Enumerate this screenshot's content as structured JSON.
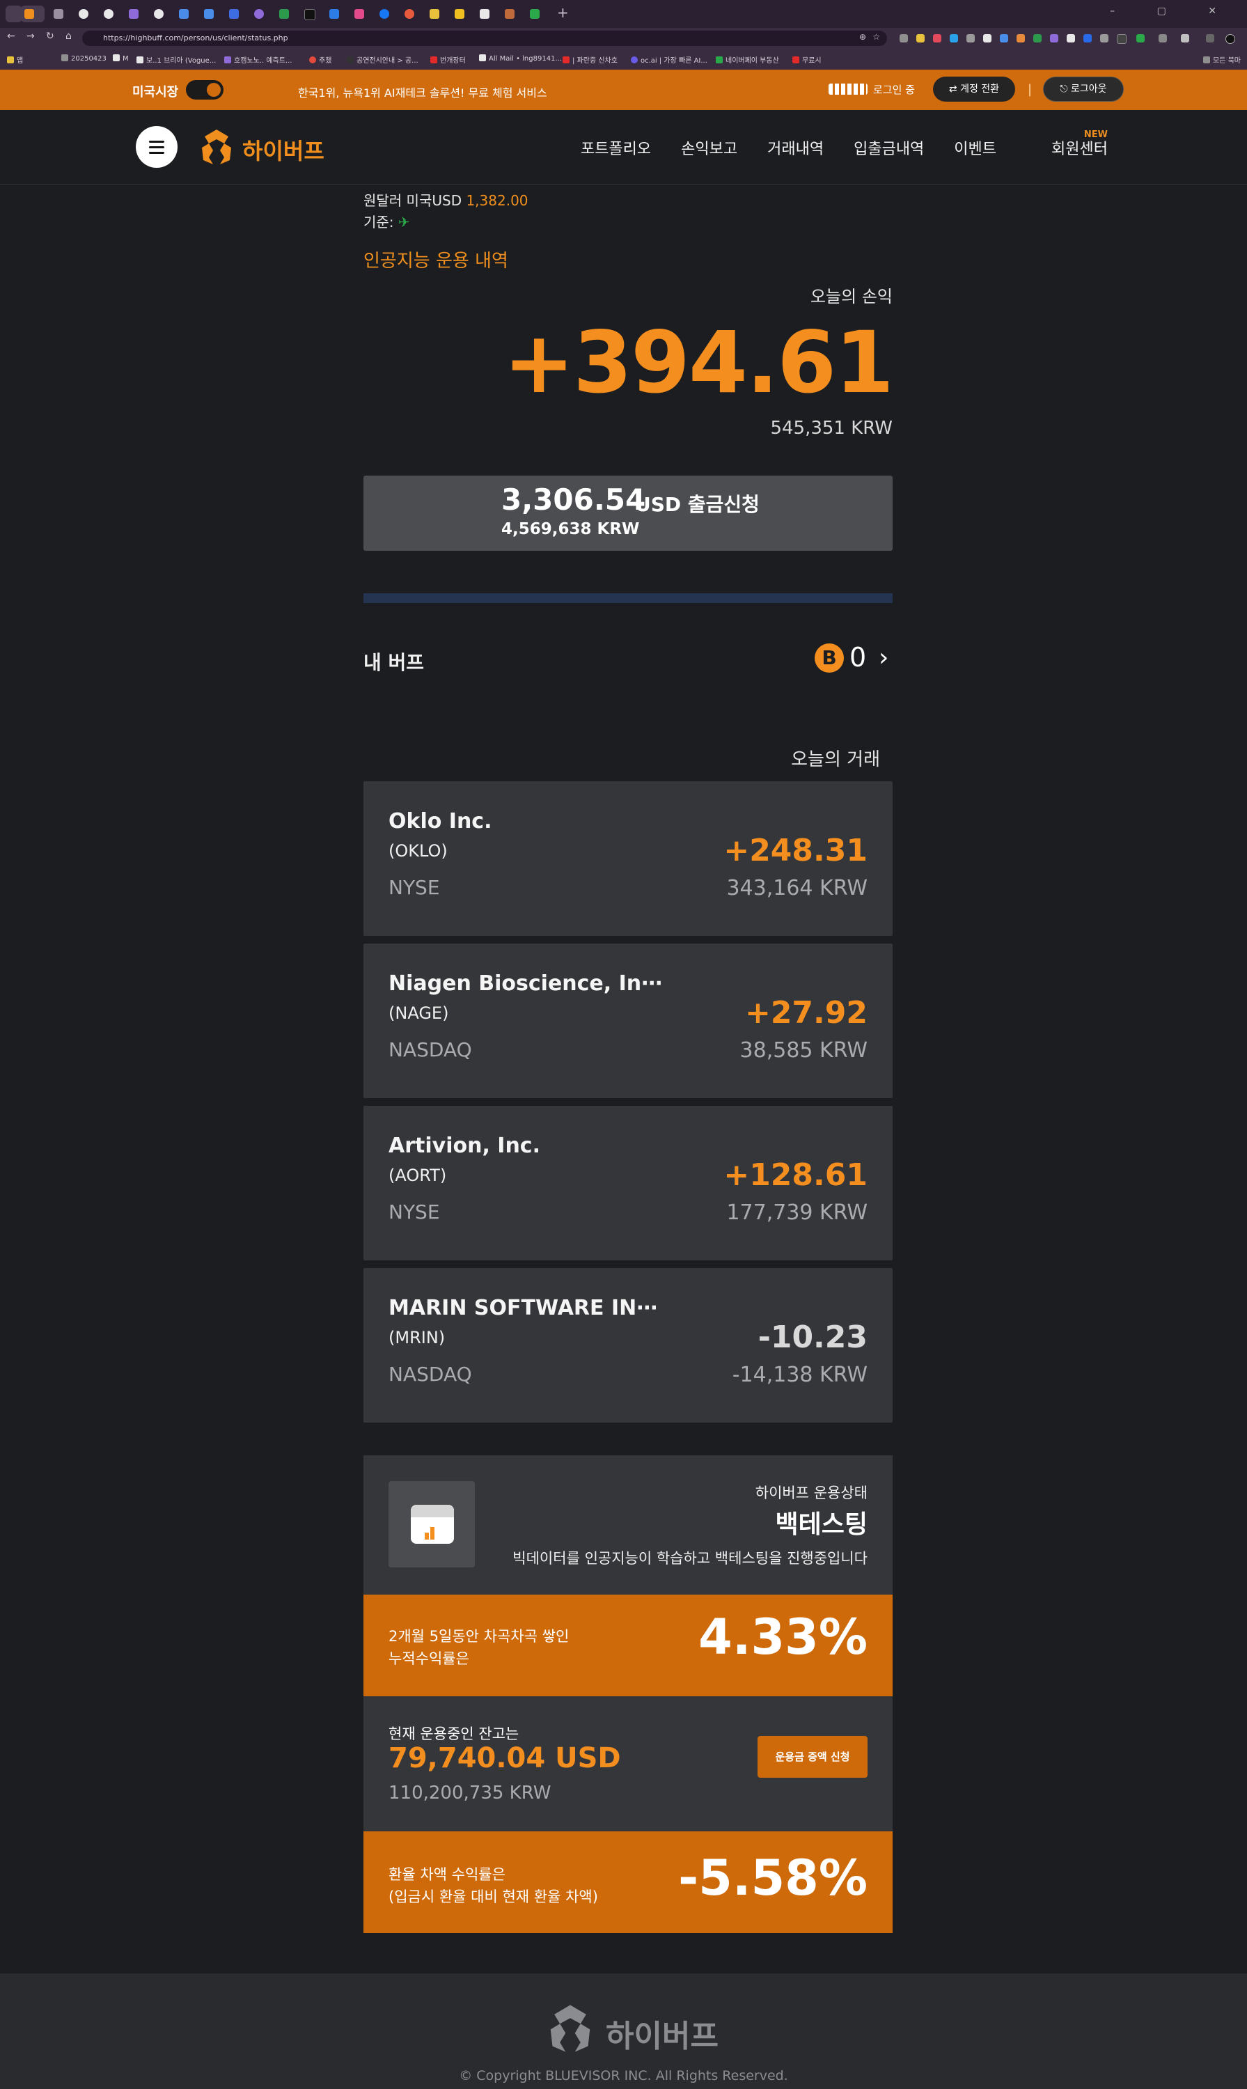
{
  "browser": {
    "url": "https://highbuff.com/person/us/client/status.php",
    "new_tab": "+",
    "window_controls": "–  ▢  ✕",
    "bookmarks": [
      "앱",
      "20250423",
      "M",
      "보..1 브리아 (Vogue...",
      "호캠노노.. 예측트...",
      "추챘",
      "공연전시안내 > 공...",
      "번개장터",
      "All Mail • lng89141...",
      "| 파란중 신차호",
      "oc.ai | 가장 빠른 AI...",
      "네이버페이 부동산",
      "무료시"
    ],
    "bookmark_right": "모든 북마"
  },
  "topbar": {
    "market_label": "미국시장",
    "promo": "한국1위, 뉴욕1위 AI재테크 솔루션! 무료 체험 서비스",
    "login_status": "로그인 중",
    "switch_account": "계정 전환",
    "separator": "|",
    "logout": "로그아웃"
  },
  "nav": {
    "logo_text": "하이버프",
    "links": [
      "포트폴리오",
      "손익보고",
      "거래내역",
      "입출금내역",
      "이벤트",
      "회원센터"
    ],
    "new_badge": "NEW"
  },
  "summary": {
    "fx_label": "원달러 미국USD",
    "fx_value": "1,382.00",
    "basis_label": "기준:",
    "section_title": "인공지능 운용 내역",
    "today_pl_label": "오늘의 손익",
    "today_pl": "+394.61",
    "today_pl_krw": "545,351 KRW",
    "withdraw_usd": "3,306.54",
    "withdraw_label": "USD 출금신청",
    "withdraw_krw": "4,569,638 KRW"
  },
  "mybuff": {
    "label": "내 버프",
    "coin": "B",
    "count": "0",
    "chevron": "›"
  },
  "trades": {
    "title": "오늘의 거래",
    "items": [
      {
        "name": "Oklo Inc.",
        "ticker": "(OKLO)",
        "exchange": "NYSE",
        "pl": "+248.31",
        "krw": "343,164 KRW"
      },
      {
        "name": "Niagen Bioscience, In⋯",
        "ticker": "(NAGE)",
        "exchange": "NASDAQ",
        "pl": "+27.92",
        "krw": "38,585 KRW"
      },
      {
        "name": "Artivion, Inc.",
        "ticker": "(AORT)",
        "exchange": "NYSE",
        "pl": "+128.61",
        "krw": "177,739 KRW"
      },
      {
        "name": "MARIN SOFTWARE IN⋯",
        "ticker": "(MRIN)",
        "exchange": "NASDAQ",
        "pl": "-10.23",
        "krw": "-14,138 KRW"
      }
    ]
  },
  "status": {
    "label": "하이버프 운용상태",
    "value": "백테스팅",
    "desc": "빅데이터를 인공지능이 학습하고 백테스팅을 진행중입니다"
  },
  "cumulative": {
    "line1": "2개월 5일동안 차곡차곡 쌓인",
    "line2": "누적수익률은",
    "value": "4.33%"
  },
  "balance": {
    "label": "현재 운용중인 잔고는",
    "usd": "79,740.04 USD",
    "krw": "110,200,735 KRW",
    "button": "운용금 증액 신청"
  },
  "fx_return": {
    "line1": "환율 차액 수익률은",
    "line2": "(입금시 환율 대비 현재 환율 차액)",
    "value": "-5.58%"
  },
  "footer": {
    "logo_text": "하이버프",
    "copyright": "© Copyright BLUEVISOR INC. All Rights Reserved."
  },
  "colors": {
    "brand_orange": "#d06c0e",
    "accent_orange": "#f48e1f",
    "background": "#1c1d20",
    "card": "#34363a"
  }
}
